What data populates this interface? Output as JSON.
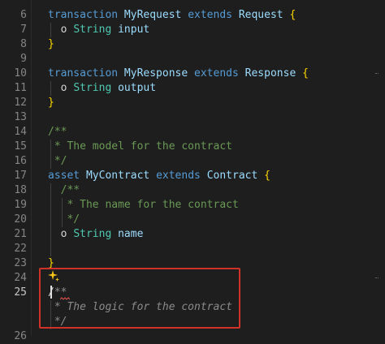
{
  "editor": {
    "lines": [
      {
        "num": "6",
        "tokens": [
          {
            "t": "transaction",
            "c": "kw"
          },
          {
            "t": " ",
            "c": "pl"
          },
          {
            "t": "MyRequest",
            "c": "id"
          },
          {
            "t": " ",
            "c": "pl"
          },
          {
            "t": "extends",
            "c": "kw"
          },
          {
            "t": " ",
            "c": "pl"
          },
          {
            "t": "Request",
            "c": "id"
          },
          {
            "t": " ",
            "c": "pl"
          },
          {
            "t": "{",
            "c": "br"
          }
        ]
      },
      {
        "num": "7",
        "tokens": [
          {
            "t": "  o ",
            "c": "pl"
          },
          {
            "t": "String",
            "c": "ty"
          },
          {
            "t": " ",
            "c": "pl"
          },
          {
            "t": "input",
            "c": "id"
          }
        ]
      },
      {
        "num": "8",
        "tokens": [
          {
            "t": "}",
            "c": "br"
          }
        ]
      },
      {
        "num": "9",
        "tokens": []
      },
      {
        "num": "10",
        "tokens": [
          {
            "t": "transaction",
            "c": "kw"
          },
          {
            "t": " ",
            "c": "pl"
          },
          {
            "t": "MyResponse",
            "c": "id"
          },
          {
            "t": " ",
            "c": "pl"
          },
          {
            "t": "extends",
            "c": "kw"
          },
          {
            "t": " ",
            "c": "pl"
          },
          {
            "t": "Response",
            "c": "id"
          },
          {
            "t": " ",
            "c": "pl"
          },
          {
            "t": "{",
            "c": "br"
          }
        ]
      },
      {
        "num": "11",
        "tokens": [
          {
            "t": "  o ",
            "c": "pl"
          },
          {
            "t": "String",
            "c": "ty"
          },
          {
            "t": " ",
            "c": "pl"
          },
          {
            "t": "output",
            "c": "id"
          }
        ]
      },
      {
        "num": "12",
        "tokens": [
          {
            "t": "}",
            "c": "br"
          }
        ]
      },
      {
        "num": "13",
        "tokens": []
      },
      {
        "num": "14",
        "tokens": [
          {
            "t": "/**",
            "c": "cm"
          }
        ]
      },
      {
        "num": "15",
        "tokens": [
          {
            "t": " * The model for the contract",
            "c": "cm"
          }
        ]
      },
      {
        "num": "16",
        "tokens": [
          {
            "t": " */",
            "c": "cm"
          }
        ]
      },
      {
        "num": "17",
        "tokens": [
          {
            "t": "asset",
            "c": "kw"
          },
          {
            "t": " ",
            "c": "pl"
          },
          {
            "t": "MyContract",
            "c": "id"
          },
          {
            "t": " ",
            "c": "pl"
          },
          {
            "t": "extends",
            "c": "kw"
          },
          {
            "t": " ",
            "c": "pl"
          },
          {
            "t": "Contract",
            "c": "id"
          },
          {
            "t": " ",
            "c": "pl"
          },
          {
            "t": "{",
            "c": "br"
          }
        ]
      },
      {
        "num": "18",
        "tokens": [
          {
            "t": "  /**",
            "c": "cm"
          }
        ]
      },
      {
        "num": "19",
        "tokens": [
          {
            "t": "   * The name for the contract",
            "c": "cm"
          }
        ]
      },
      {
        "num": "20",
        "tokens": [
          {
            "t": "   */",
            "c": "cm"
          }
        ]
      },
      {
        "num": "21",
        "tokens": [
          {
            "t": "  o ",
            "c": "pl"
          },
          {
            "t": "String",
            "c": "ty"
          },
          {
            "t": " ",
            "c": "pl"
          },
          {
            "t": "name",
            "c": "id"
          }
        ]
      },
      {
        "num": "22",
        "tokens": []
      },
      {
        "num": "23",
        "tokens": [
          {
            "t": "}",
            "c": "br"
          }
        ]
      },
      {
        "num": "24",
        "tokens": []
      },
      {
        "num": "25",
        "tokens": [
          {
            "t": "/",
            "c": "pl"
          },
          {
            "t": "**",
            "c": "ghost"
          }
        ],
        "active": true
      },
      {
        "num": "",
        "tokens": [
          {
            "t": " * The logic for the contract",
            "c": "ghost"
          }
        ]
      },
      {
        "num": "",
        "tokens": [
          {
            "t": " */",
            "c": "ghost"
          }
        ]
      },
      {
        "num": "26",
        "tokens": []
      }
    ]
  },
  "inline_suggestion": {
    "icon": "sparkle-icon",
    "color": "#f5c518"
  },
  "colors": {
    "highlight_border": "#d0322a",
    "background": "#1e1e1e"
  }
}
